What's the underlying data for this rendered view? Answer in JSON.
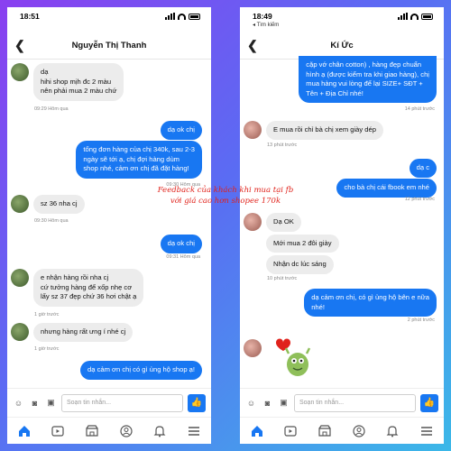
{
  "colors": {
    "accent": "#1877f2",
    "incoming": "#ececec",
    "overlay": "#e0221b"
  },
  "left": {
    "status_time": "18:51",
    "title": "Nguyễn Thị Thanh",
    "messages": [
      {
        "text": "dạ\nhihi shop mịh đc 2 màu\nnên phải mua 2 màu chứ"
      },
      {
        "ts": "09:29 Hôm qua"
      },
      {
        "text": "dạ ok chị"
      },
      {
        "text": "tổng đơn hàng của chị 340k, sau 2-3\nngày sẽ tới ạ, chị đợi hàng dùm\nshop nhé, cảm ơn chị đã đặt hàng!"
      },
      {
        "ts": "09:30 Hôm qua"
      },
      {
        "text": "sz 36 nha cj"
      },
      {
        "ts": "09:30 Hôm qua"
      },
      {
        "text": "dạ ok chị"
      },
      {
        "ts": "09:31 Hôm qua"
      },
      {
        "text": "e nhận hàng rồi nha cj\ncứ tưởng hàng để xốp nhẹ cơ\nlấy sz 37 đẹp chứ 36 hơi chật ạ"
      },
      {
        "ts": "1 giờ trước"
      },
      {
        "text": "nhưng hàng rất ưng í nhé cj"
      },
      {
        "ts": "1 giờ trước"
      },
      {
        "text": "dạ cảm ơn chị có gì ủng hộ shop ạ!"
      }
    ],
    "composer_placeholder": "Soạn tin nhắn..."
  },
  "right": {
    "status_time": "18:49",
    "back_app": "◂ Tìm kiếm",
    "title": "Kí Ức",
    "messages": [
      {
        "text": "cặp vớ chân cotton) , hàng đẹp chuẩn\nhình ạ (được kiểm tra khi giao hàng), chị\nmua hàng vui lòng để lại SIZE+ SĐT +\nTên + Địa Chỉ nhé!"
      },
      {
        "ts": "14 phút trước"
      },
      {
        "text": "E mua rồi chỉ bà chị xem giày dép"
      },
      {
        "ts": "13 phút trước"
      },
      {
        "text": "dạ c"
      },
      {
        "text": "cho bà chị cái fbook em nhé"
      },
      {
        "ts": "12 phút trước"
      },
      {
        "text": "Dạ OK"
      },
      {
        "text": "Mới mua 2 đôi giày"
      },
      {
        "text": "Nhận dc lúc sáng"
      },
      {
        "ts": "10 phút trước"
      },
      {
        "text": "dạ cảm ơn chị, có gì ủng hộ bên e nữa\nnhé!"
      },
      {
        "ts": "2 phút trước"
      }
    ],
    "composer_placeholder": "Soạn tin nhắn..."
  },
  "overlay_text": "Feedback của khách khi mua tại fb\nvới giá cao hơn shopee 170k"
}
